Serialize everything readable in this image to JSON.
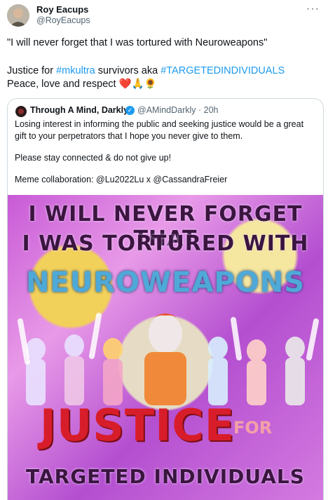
{
  "author": {
    "name": "Roy Eacups",
    "handle": "@RoyEacups"
  },
  "menu": {
    "more_label": "···"
  },
  "tweet": {
    "line1": "\"I will never forget that I was tortured with Neuroweapons\"",
    "line2_prefix": "Justice for ",
    "line2_tag1": "#mkultra",
    "line2_mid": " survivors aka ",
    "line2_tag2": "#TARGETEDINDIVIDUALS",
    "line3": "Peace, love and respect ",
    "line3_emoji_heart": "❤️",
    "line3_emoji_pray": "🙏",
    "line3_emoji_sunflower": "🌻"
  },
  "quote": {
    "name": "Through A Mind, Darkly",
    "verified": "✓",
    "handle_time": "@AMindDarkly · 20h",
    "text1": "Losing interest in informing the public and seeking justice would be a great gift to your perpetrators that I hope you never give to them.",
    "text2": "Please stay connected & do not give up!",
    "text3": "Meme collaboration:  @Lu2022Lu x @CassandraFreier"
  },
  "meme": {
    "line1": "I WILL NEVER FORGET THAT",
    "line2": "I  WAS  TORTURED  WITH",
    "line3": "NEUROWEAPONS",
    "line4": "JUSTICE",
    "line4b": "FOR",
    "line5": "TARGETED  INDIVIDUALS"
  },
  "colors": {
    "accent": "#1d9bf0",
    "meme_red": "#d81d2a",
    "meme_blue": "#4fa9d8",
    "meme_purple": "#c85ad6"
  }
}
